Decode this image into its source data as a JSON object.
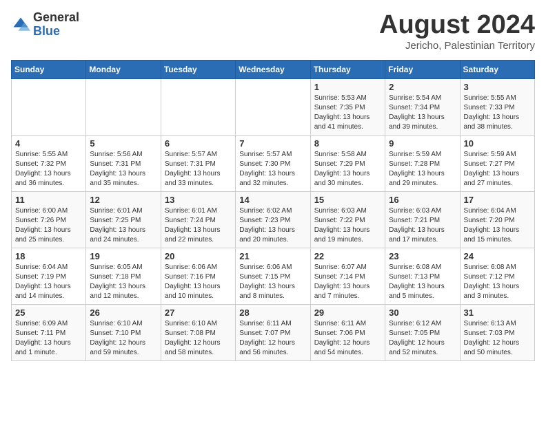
{
  "logo": {
    "general": "General",
    "blue": "Blue"
  },
  "title": {
    "month_year": "August 2024",
    "location": "Jericho, Palestinian Territory"
  },
  "header_days": [
    "Sunday",
    "Monday",
    "Tuesday",
    "Wednesday",
    "Thursday",
    "Friday",
    "Saturday"
  ],
  "weeks": [
    [
      {
        "day": "",
        "sunrise": "",
        "sunset": "",
        "daylight": ""
      },
      {
        "day": "",
        "sunrise": "",
        "sunset": "",
        "daylight": ""
      },
      {
        "day": "",
        "sunrise": "",
        "sunset": "",
        "daylight": ""
      },
      {
        "day": "",
        "sunrise": "",
        "sunset": "",
        "daylight": ""
      },
      {
        "day": "1",
        "sunrise": "Sunrise: 5:53 AM",
        "sunset": "Sunset: 7:35 PM",
        "daylight": "Daylight: 13 hours and 41 minutes."
      },
      {
        "day": "2",
        "sunrise": "Sunrise: 5:54 AM",
        "sunset": "Sunset: 7:34 PM",
        "daylight": "Daylight: 13 hours and 39 minutes."
      },
      {
        "day": "3",
        "sunrise": "Sunrise: 5:55 AM",
        "sunset": "Sunset: 7:33 PM",
        "daylight": "Daylight: 13 hours and 38 minutes."
      }
    ],
    [
      {
        "day": "4",
        "sunrise": "Sunrise: 5:55 AM",
        "sunset": "Sunset: 7:32 PM",
        "daylight": "Daylight: 13 hours and 36 minutes."
      },
      {
        "day": "5",
        "sunrise": "Sunrise: 5:56 AM",
        "sunset": "Sunset: 7:31 PM",
        "daylight": "Daylight: 13 hours and 35 minutes."
      },
      {
        "day": "6",
        "sunrise": "Sunrise: 5:57 AM",
        "sunset": "Sunset: 7:31 PM",
        "daylight": "Daylight: 13 hours and 33 minutes."
      },
      {
        "day": "7",
        "sunrise": "Sunrise: 5:57 AM",
        "sunset": "Sunset: 7:30 PM",
        "daylight": "Daylight: 13 hours and 32 minutes."
      },
      {
        "day": "8",
        "sunrise": "Sunrise: 5:58 AM",
        "sunset": "Sunset: 7:29 PM",
        "daylight": "Daylight: 13 hours and 30 minutes."
      },
      {
        "day": "9",
        "sunrise": "Sunrise: 5:59 AM",
        "sunset": "Sunset: 7:28 PM",
        "daylight": "Daylight: 13 hours and 29 minutes."
      },
      {
        "day": "10",
        "sunrise": "Sunrise: 5:59 AM",
        "sunset": "Sunset: 7:27 PM",
        "daylight": "Daylight: 13 hours and 27 minutes."
      }
    ],
    [
      {
        "day": "11",
        "sunrise": "Sunrise: 6:00 AM",
        "sunset": "Sunset: 7:26 PM",
        "daylight": "Daylight: 13 hours and 25 minutes."
      },
      {
        "day": "12",
        "sunrise": "Sunrise: 6:01 AM",
        "sunset": "Sunset: 7:25 PM",
        "daylight": "Daylight: 13 hours and 24 minutes."
      },
      {
        "day": "13",
        "sunrise": "Sunrise: 6:01 AM",
        "sunset": "Sunset: 7:24 PM",
        "daylight": "Daylight: 13 hours and 22 minutes."
      },
      {
        "day": "14",
        "sunrise": "Sunrise: 6:02 AM",
        "sunset": "Sunset: 7:23 PM",
        "daylight": "Daylight: 13 hours and 20 minutes."
      },
      {
        "day": "15",
        "sunrise": "Sunrise: 6:03 AM",
        "sunset": "Sunset: 7:22 PM",
        "daylight": "Daylight: 13 hours and 19 minutes."
      },
      {
        "day": "16",
        "sunrise": "Sunrise: 6:03 AM",
        "sunset": "Sunset: 7:21 PM",
        "daylight": "Daylight: 13 hours and 17 minutes."
      },
      {
        "day": "17",
        "sunrise": "Sunrise: 6:04 AM",
        "sunset": "Sunset: 7:20 PM",
        "daylight": "Daylight: 13 hours and 15 minutes."
      }
    ],
    [
      {
        "day": "18",
        "sunrise": "Sunrise: 6:04 AM",
        "sunset": "Sunset: 7:19 PM",
        "daylight": "Daylight: 13 hours and 14 minutes."
      },
      {
        "day": "19",
        "sunrise": "Sunrise: 6:05 AM",
        "sunset": "Sunset: 7:18 PM",
        "daylight": "Daylight: 13 hours and 12 minutes."
      },
      {
        "day": "20",
        "sunrise": "Sunrise: 6:06 AM",
        "sunset": "Sunset: 7:16 PM",
        "daylight": "Daylight: 13 hours and 10 minutes."
      },
      {
        "day": "21",
        "sunrise": "Sunrise: 6:06 AM",
        "sunset": "Sunset: 7:15 PM",
        "daylight": "Daylight: 13 hours and 8 minutes."
      },
      {
        "day": "22",
        "sunrise": "Sunrise: 6:07 AM",
        "sunset": "Sunset: 7:14 PM",
        "daylight": "Daylight: 13 hours and 7 minutes."
      },
      {
        "day": "23",
        "sunrise": "Sunrise: 6:08 AM",
        "sunset": "Sunset: 7:13 PM",
        "daylight": "Daylight: 13 hours and 5 minutes."
      },
      {
        "day": "24",
        "sunrise": "Sunrise: 6:08 AM",
        "sunset": "Sunset: 7:12 PM",
        "daylight": "Daylight: 13 hours and 3 minutes."
      }
    ],
    [
      {
        "day": "25",
        "sunrise": "Sunrise: 6:09 AM",
        "sunset": "Sunset: 7:11 PM",
        "daylight": "Daylight: 13 hours and 1 minute."
      },
      {
        "day": "26",
        "sunrise": "Sunrise: 6:10 AM",
        "sunset": "Sunset: 7:10 PM",
        "daylight": "Daylight: 12 hours and 59 minutes."
      },
      {
        "day": "27",
        "sunrise": "Sunrise: 6:10 AM",
        "sunset": "Sunset: 7:08 PM",
        "daylight": "Daylight: 12 hours and 58 minutes."
      },
      {
        "day": "28",
        "sunrise": "Sunrise: 6:11 AM",
        "sunset": "Sunset: 7:07 PM",
        "daylight": "Daylight: 12 hours and 56 minutes."
      },
      {
        "day": "29",
        "sunrise": "Sunrise: 6:11 AM",
        "sunset": "Sunset: 7:06 PM",
        "daylight": "Daylight: 12 hours and 54 minutes."
      },
      {
        "day": "30",
        "sunrise": "Sunrise: 6:12 AM",
        "sunset": "Sunset: 7:05 PM",
        "daylight": "Daylight: 12 hours and 52 minutes."
      },
      {
        "day": "31",
        "sunrise": "Sunrise: 6:13 AM",
        "sunset": "Sunset: 7:03 PM",
        "daylight": "Daylight: 12 hours and 50 minutes."
      }
    ]
  ]
}
